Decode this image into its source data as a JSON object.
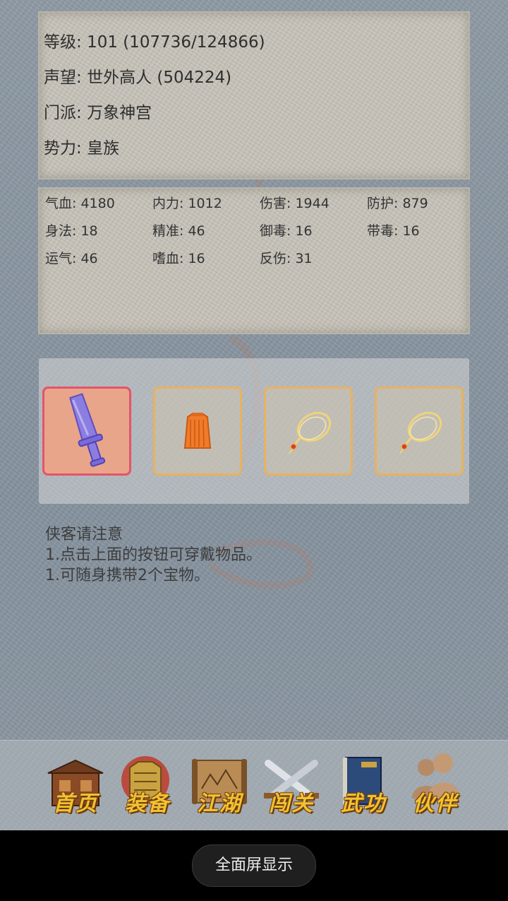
{
  "character": {
    "level_label": "等级:",
    "level_value": "101 (107736/124866)",
    "fame_label": "声望:",
    "fame_value": "世外高人 (504224)",
    "sect_label": "门派:",
    "sect_value": "万象神宫",
    "faction_label": "势力:",
    "faction_value": "皇族"
  },
  "stats": [
    {
      "label": "气血",
      "value": "4180"
    },
    {
      "label": "内力",
      "value": "1012"
    },
    {
      "label": "伤害",
      "value": "1944"
    },
    {
      "label": "防护",
      "value": "879"
    },
    {
      "label": "身法",
      "value": "18"
    },
    {
      "label": "精准",
      "value": "46"
    },
    {
      "label": "御毒",
      "value": "16"
    },
    {
      "label": "带毒",
      "value": "16"
    },
    {
      "label": "运气",
      "value": "46"
    },
    {
      "label": "嗜血",
      "value": "16"
    },
    {
      "label": "反伤",
      "value": "31"
    }
  ],
  "equipment": [
    {
      "icon": "sword-icon",
      "active": true
    },
    {
      "icon": "armor-vest-icon",
      "active": false
    },
    {
      "icon": "necklace-icon",
      "active": false
    },
    {
      "icon": "necklace-icon",
      "active": false
    }
  ],
  "notice": {
    "title": "侠客请注意",
    "line1": "1.点击上面的按钮可穿戴物品。",
    "line2": "1.可随身携带2个宝物。"
  },
  "nav": [
    {
      "label": "首页",
      "icon": "house-icon"
    },
    {
      "label": "装备",
      "icon": "armor-icon"
    },
    {
      "label": "江湖",
      "icon": "scroll-map-icon"
    },
    {
      "label": "闯关",
      "icon": "crossed-swords-icon"
    },
    {
      "label": "武功",
      "icon": "book-icon"
    },
    {
      "label": "伙伴",
      "icon": "partners-icon"
    }
  ],
  "system": {
    "fullscreen_label": "全面屏显示"
  },
  "colors": {
    "background": "#8a97a3",
    "panel": "#c6c2b8",
    "slot_border": "#e8b25e",
    "slot_active_border": "#e3546a",
    "nav_label": "#f1c232"
  }
}
